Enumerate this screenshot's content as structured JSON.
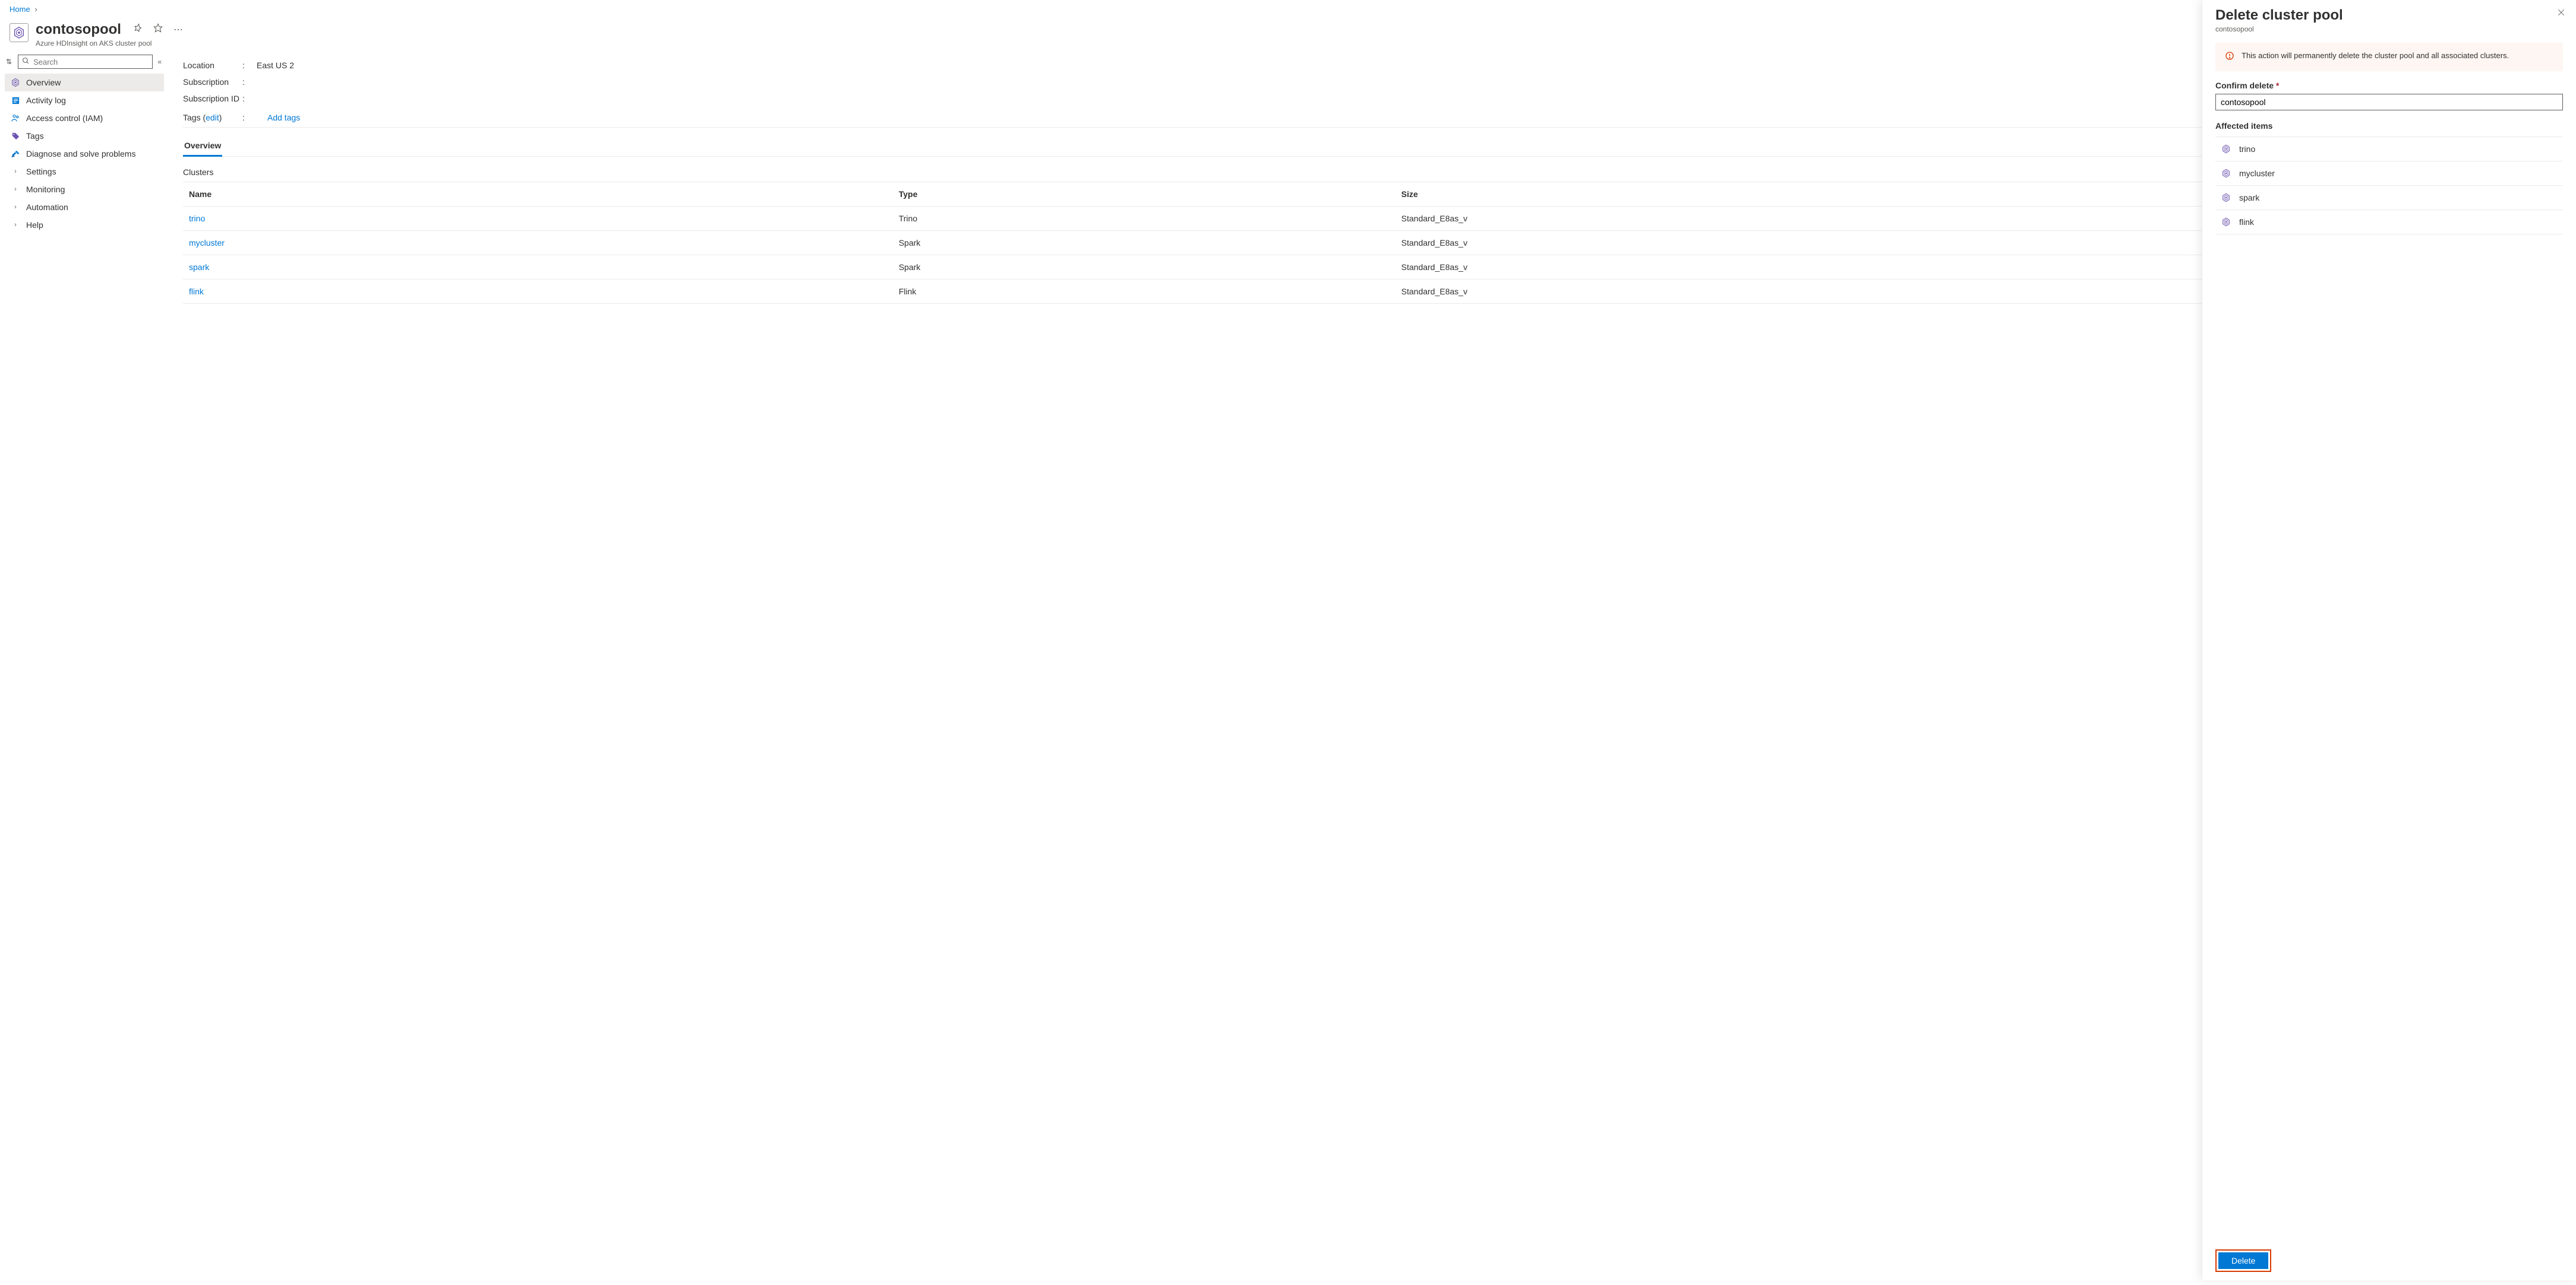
{
  "breadcrumb": {
    "home": "Home"
  },
  "header": {
    "title": "contosopool",
    "subtitle": "Azure HDInsight on AKS cluster pool"
  },
  "sidebar": {
    "search_placeholder": "Search",
    "items": [
      {
        "label": "Overview"
      },
      {
        "label": "Activity log"
      },
      {
        "label": "Access control (IAM)"
      },
      {
        "label": "Tags"
      },
      {
        "label": "Diagnose and solve problems"
      },
      {
        "label": "Settings"
      },
      {
        "label": "Monitoring"
      },
      {
        "label": "Automation"
      },
      {
        "label": "Help"
      }
    ]
  },
  "details": {
    "location_label": "Location",
    "location_value": "East US 2",
    "subscription_label": "Subscription",
    "subscription_id_label": "Subscription ID",
    "tags_label": "Tags",
    "tags_edit": "edit",
    "tags_add": "Add tags"
  },
  "tabs": {
    "overview": "Overview"
  },
  "clusters": {
    "title": "Clusters",
    "cols": {
      "name": "Name",
      "type": "Type",
      "size": "Size"
    },
    "rows": [
      {
        "name": "trino",
        "type": "Trino",
        "size": "Standard_E8as_v"
      },
      {
        "name": "mycluster",
        "type": "Spark",
        "size": "Standard_E8as_v"
      },
      {
        "name": "spark",
        "type": "Spark",
        "size": "Standard_E8as_v"
      },
      {
        "name": "flink",
        "type": "Flink",
        "size": "Standard_E8as_v"
      }
    ]
  },
  "panel": {
    "title": "Delete cluster pool",
    "subtitle": "contosopool",
    "warning": "This action will permanently delete the cluster pool and all associated clusters.",
    "confirm_label": "Confirm delete",
    "confirm_value": "contosopool",
    "affected_label": "Affected items",
    "affected": [
      {
        "name": "trino"
      },
      {
        "name": "mycluster"
      },
      {
        "name": "spark"
      },
      {
        "name": "flink"
      }
    ],
    "delete_btn": "Delete"
  }
}
